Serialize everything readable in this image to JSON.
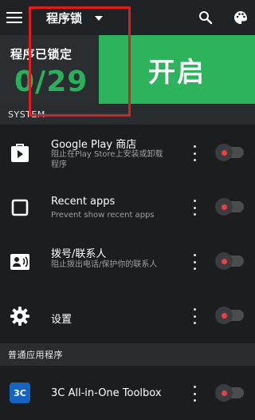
{
  "topbar": {
    "title": "程序锁",
    "icons": {
      "menu": "hamburger-menu-icon",
      "dropdown": "caret-down-icon",
      "search": "search-icon",
      "palette": "palette-icon"
    }
  },
  "hero": {
    "label": "程序已锁定",
    "count": "0/29",
    "open_button": "开启"
  },
  "sections": [
    {
      "header": "SYSTEM"
    },
    {
      "header": "普通应用程序"
    }
  ],
  "system_items": [
    {
      "title": "Google Play 商店",
      "subtitle": "阻止在Play Store上安装或卸载程序",
      "icon": "play-store-icon"
    },
    {
      "title": "Recent apps",
      "subtitle": "Prevent show recent apps",
      "icon": "recent-apps-icon"
    },
    {
      "title": "拨号/联系人",
      "subtitle": "阻止拨出电话/保护你的联系人",
      "icon": "contacts-icon"
    },
    {
      "title": "设置",
      "subtitle": "",
      "icon": "settings-gear-icon"
    }
  ],
  "app_items": [
    {
      "title": "3C All-in-One Toolbox",
      "subtitle": "",
      "icon": "3c-toolbox-icon",
      "icon_text": "3C"
    }
  ],
  "colors": {
    "accent_green": "#2db35c",
    "count_green": "#29b05a",
    "switch_dot_red": "#e0434a",
    "highlight_red": "#e11b1b"
  }
}
